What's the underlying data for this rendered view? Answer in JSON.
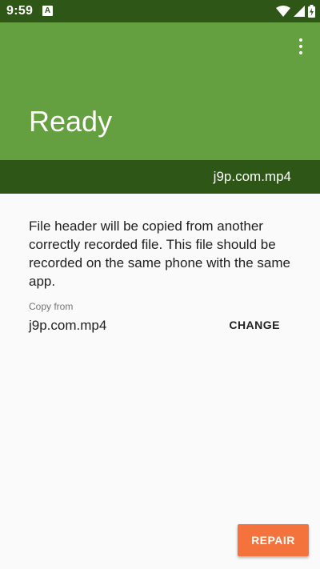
{
  "status_bar": {
    "time": "9:59",
    "app_icon_letter": "A",
    "icons": [
      "wifi-icon",
      "signal-icon",
      "battery-charging-icon"
    ]
  },
  "header": {
    "title": "Ready",
    "menu_icon": "more-vert-icon",
    "file_name": "j9p.com.mp4"
  },
  "content": {
    "description": "File header will be copied from another correctly recorded file. This file should be recorded on the same phone with the same app.",
    "copy_from_label": "Copy from",
    "copy_from_value": "j9p.com.mp4",
    "change_label": "CHANGE",
    "repair_label": "REPAIR"
  },
  "colors": {
    "status_bar": "#2e5717",
    "header": "#64a03f",
    "file_bar": "#2e5717",
    "accent": "#f4733d",
    "background": "#fafafa"
  }
}
